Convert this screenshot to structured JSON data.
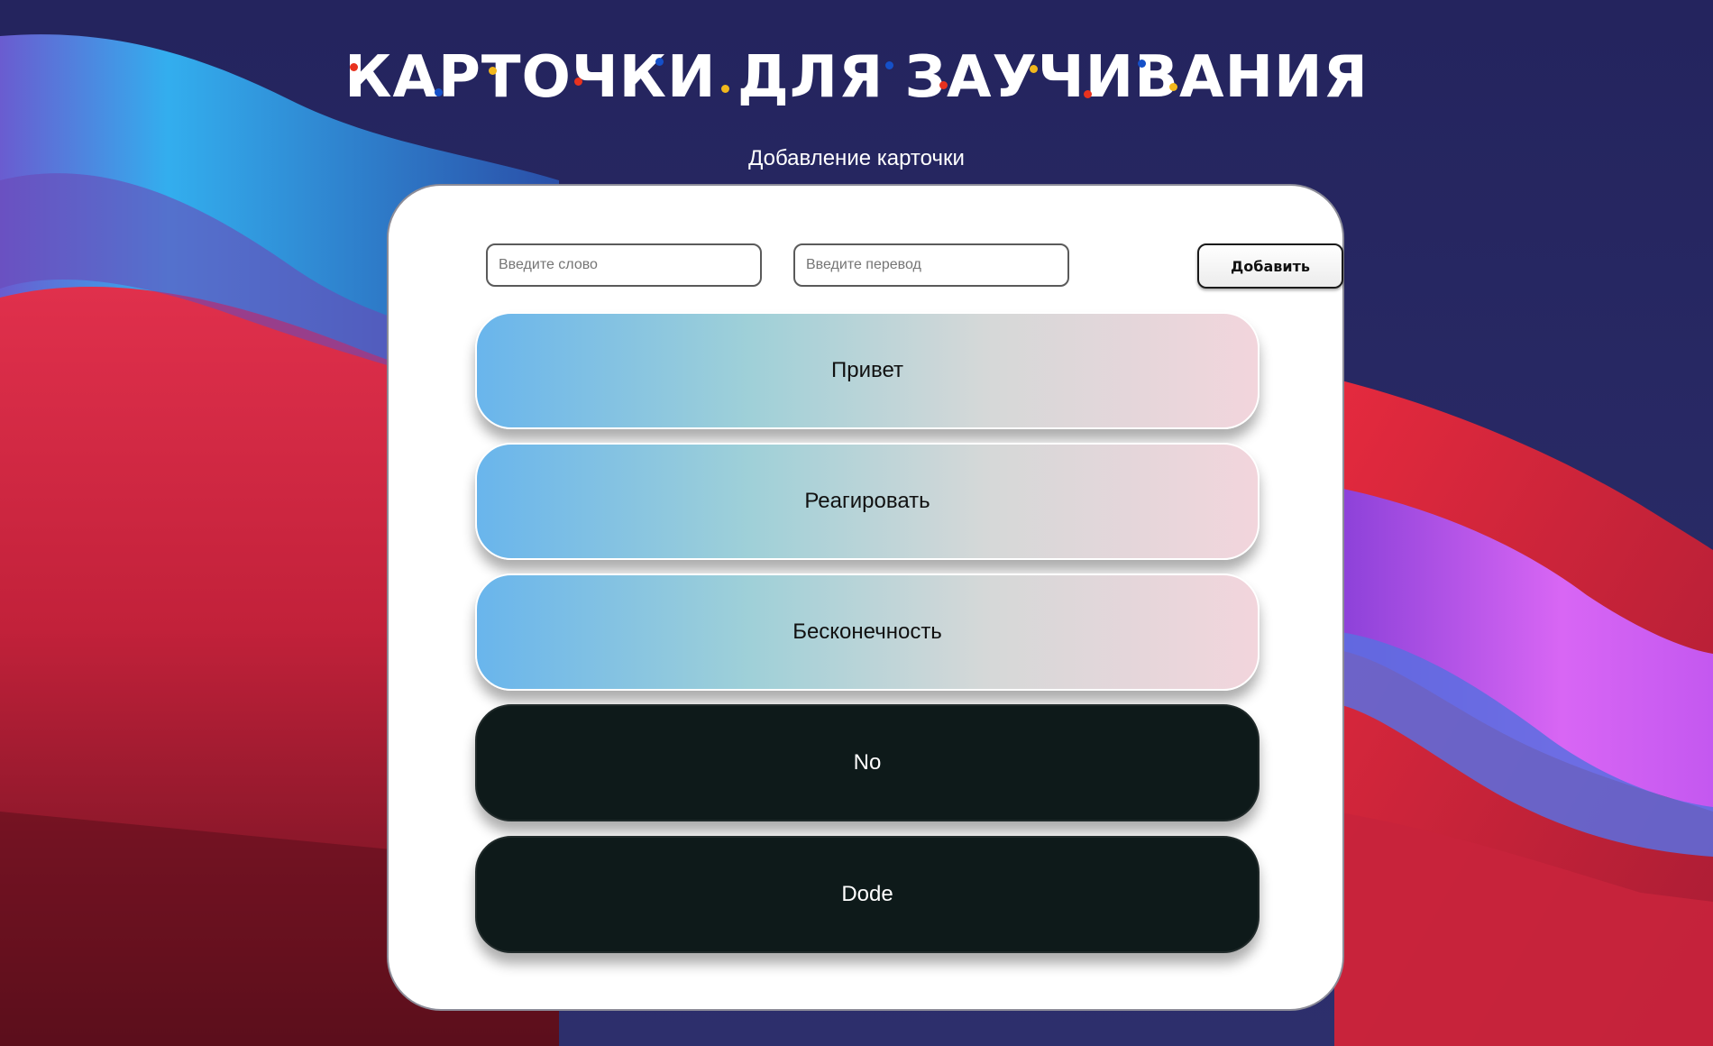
{
  "page": {
    "title": "КАРТОЧКИ ДЛЯ ЗАУЧИВАНИЯ",
    "subtitle": "Добавление карточки"
  },
  "form": {
    "word_placeholder": "Введите слово",
    "translation_placeholder": "Введите перевод",
    "add_label": "Добавить"
  },
  "cards": [
    {
      "text": "Привет",
      "style": "light"
    },
    {
      "text": "Реагировать",
      "style": "light"
    },
    {
      "text": "Бесконечность",
      "style": "light"
    },
    {
      "text": "No",
      "style": "dark"
    },
    {
      "text": "Dode",
      "style": "dark"
    }
  ],
  "colors": {
    "card_gradient_start": "#69b5ec",
    "card_gradient_end": "#f2d5dc",
    "card_dark": "#0e1a1a",
    "background_navy": "#2a2963",
    "background_red": "#d82a44",
    "background_cyan": "#38b2ee",
    "background_violet": "#c560f0",
    "title_dot_red": "#e8321e",
    "title_dot_blue": "#1550c8",
    "title_dot_yellow": "#f2b81c"
  }
}
